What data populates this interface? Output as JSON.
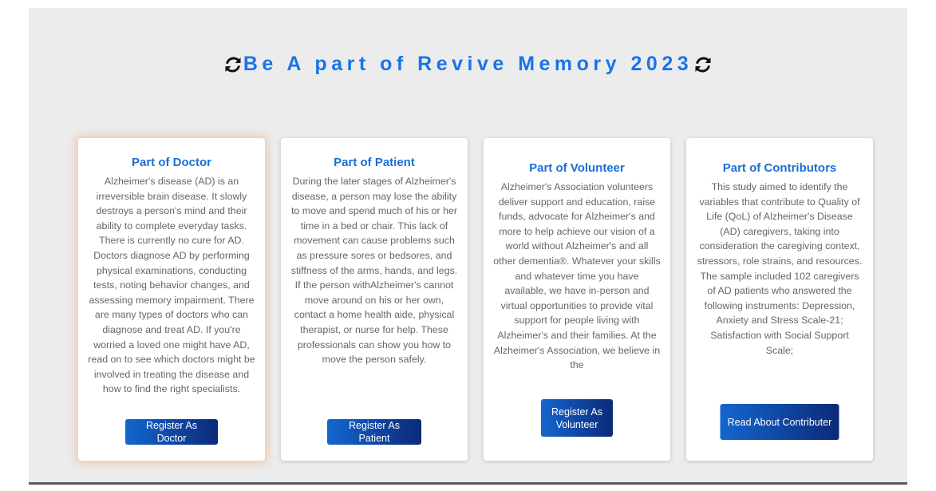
{
  "header": {
    "title": "Be A part of Revive Memory 2023",
    "left_icon": "refresh-icon",
    "right_icon": "refresh-icon"
  },
  "cards": [
    {
      "title": "Part of Doctor",
      "text": "Alzheimer's disease (AD) is an irreversible brain disease. It slowly destroys a person's mind and their ability to complete everyday tasks. There is currently no cure for AD. Doctors diagnose AD by performing physical examinations, conducting tests, noting behavior changes, and assessing memory impairment. There are many types of doctors who can diagnose and treat AD. If you're worried a loved one might have AD, read on to see which doctors might be involved in treating the disease and how to find the right specialists.",
      "button": "Register As Doctor"
    },
    {
      "title": "Part of Patient",
      "text": "During the later stages of Alzheimer's disease, a person may lose the ability to move and spend much of his or her time in a bed or chair. This lack of movement can cause problems such as pressure sores or bedsores, and stiffness of the arms, hands, and legs. If the person withAlzheimer's cannot move around on his or her own, contact a home health aide, physical therapist, or nurse for help. These professionals can show you how to move the person safely.",
      "button": "Register As Patient"
    },
    {
      "title": "Part of Volunteer",
      "text": "Alzheimer's Association volunteers deliver support and education, raise funds, advocate for Alzheimer's and more to help achieve our vision of a world without Alzheimer's and all other dementia®. Whatever your skills and whatever time you have available, we have in-person and virtual opportunities to provide vital support for people living with Alzheimer's and their families. At the Alzheimer's Association, we believe in the",
      "button": "Register As Volunteer"
    },
    {
      "title": "Part of Contributors",
      "text": "This study aimed to identify the variables that contribute to Quality of Life (QoL) of Alzheimer's Disease (AD) caregivers, taking into consideration the caregiving context, stressors, role strains, and resources. The sample included 102 caregivers of AD patients who answered the following instruments: Depression, Anxiety and Stress Scale-21; Satisfaction with Social Support Scale;",
      "button": "Read About Contributer"
    }
  ],
  "colors": {
    "accent": "#1a73e8",
    "button_start": "#1466d0",
    "button_end": "#0b2a78",
    "background": "#ececec",
    "highlight_glow": "#f0aa78"
  }
}
